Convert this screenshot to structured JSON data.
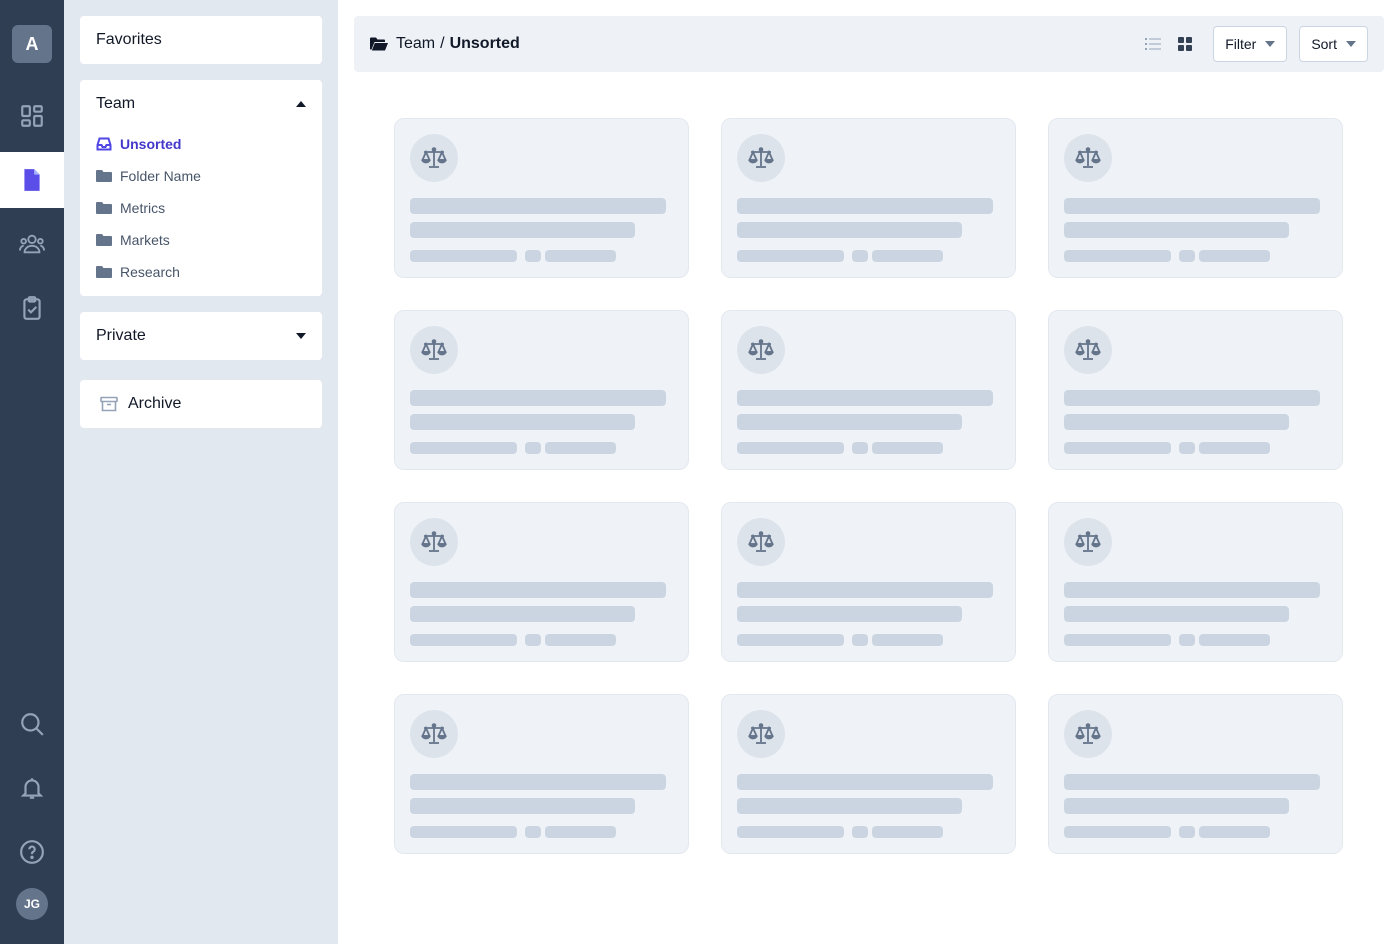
{
  "rail": {
    "logo_letter": "A",
    "avatar_initials": "JG"
  },
  "sidebar": {
    "favorites_label": "Favorites",
    "team_label": "Team",
    "team_folders": [
      "Unsorted",
      "Folder Name",
      "Metrics",
      "Markets",
      "Research"
    ],
    "private_label": "Private",
    "archive_label": "Archive"
  },
  "toolbar": {
    "breadcrumb_parent": "Team",
    "breadcrumb_separator": "/",
    "breadcrumb_current": "Unsorted",
    "filter_label": "Filter",
    "sort_label": "Sort"
  },
  "cards": {
    "count": 12,
    "icon": "scale-balance-icon",
    "state": "loading-placeholder"
  },
  "colors": {
    "rail_bg": "#2f3e52",
    "accent": "#4f46e5",
    "sidebar_bg": "#e2e8f0"
  }
}
